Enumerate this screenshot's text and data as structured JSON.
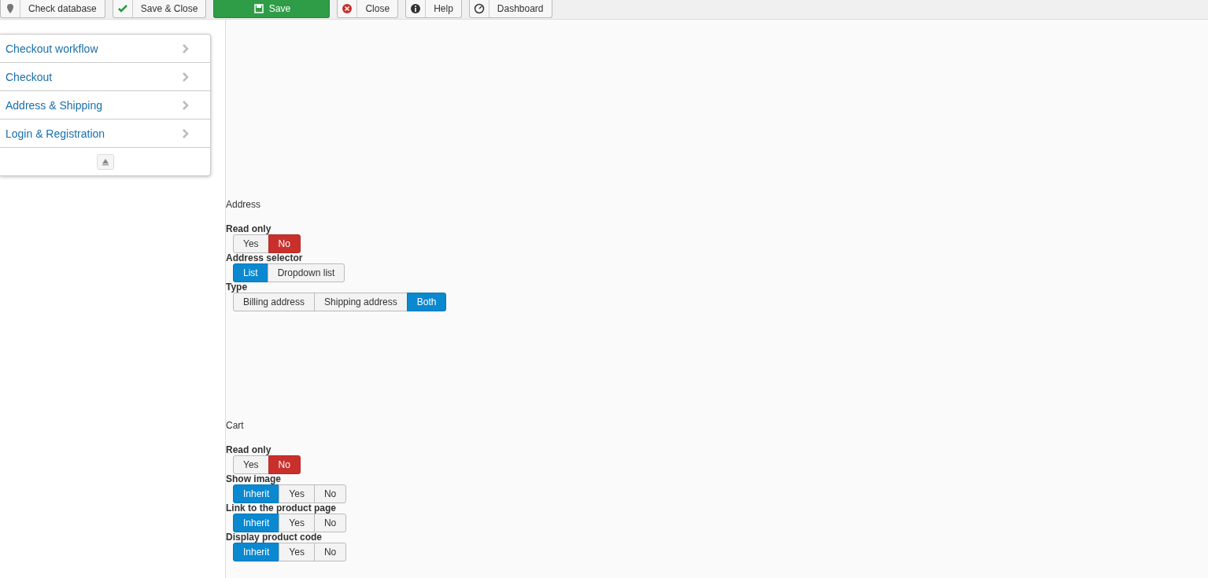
{
  "toolbar": [
    {
      "label": "Check database",
      "kind": "plain"
    },
    {
      "label": "Save & Close",
      "kind": "plain"
    },
    {
      "label": "Save",
      "kind": "success"
    },
    {
      "label": "Close",
      "kind": "plain"
    },
    {
      "label": "Help",
      "kind": "plain"
    },
    {
      "label": "Dashboard",
      "kind": "plain"
    }
  ],
  "sidebar": {
    "items": [
      {
        "label": "Checkout workflow"
      },
      {
        "label": "Checkout"
      },
      {
        "label": "Address & Shipping"
      },
      {
        "label": "Login & Registration"
      }
    ]
  },
  "sections": [
    {
      "title": "Address",
      "fields": [
        {
          "label": "Read only",
          "kind": "danger",
          "options": [
            {
              "label": "Yes",
              "selected": false
            },
            {
              "label": "No",
              "selected": true
            }
          ]
        },
        {
          "label": "Address selector",
          "kind": "primary",
          "options": [
            {
              "label": "List",
              "selected": true
            },
            {
              "label": "Dropdown list",
              "selected": false
            }
          ]
        },
        {
          "label": "Type",
          "kind": "primary",
          "options": [
            {
              "label": "Billing address",
              "selected": false
            },
            {
              "label": "Shipping address",
              "selected": false
            },
            {
              "label": "Both",
              "selected": true
            }
          ]
        }
      ]
    },
    {
      "title": "Cart",
      "fields": [
        {
          "label": "Read only",
          "kind": "danger",
          "options": [
            {
              "label": "Yes",
              "selected": false
            },
            {
              "label": "No",
              "selected": true
            }
          ]
        },
        {
          "label": "Show image",
          "kind": "primary",
          "options": [
            {
              "label": "Inherit",
              "selected": true
            },
            {
              "label": "Yes",
              "selected": false
            },
            {
              "label": "No",
              "selected": false
            }
          ]
        },
        {
          "label": "Link to the product page",
          "kind": "primary",
          "options": [
            {
              "label": "Inherit",
              "selected": true
            },
            {
              "label": "Yes",
              "selected": false
            },
            {
              "label": "No",
              "selected": false
            }
          ]
        },
        {
          "label": "Display product code",
          "kind": "primary",
          "options": [
            {
              "label": "Inherit",
              "selected": true
            },
            {
              "label": "Yes",
              "selected": false
            },
            {
              "label": "No",
              "selected": false
            }
          ]
        }
      ]
    }
  ]
}
